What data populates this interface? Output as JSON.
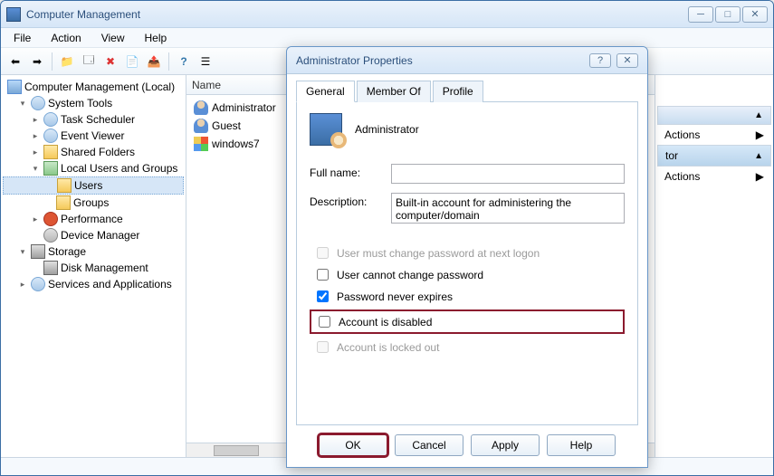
{
  "window": {
    "title": "Computer Management"
  },
  "menus": [
    "File",
    "Action",
    "View",
    "Help"
  ],
  "tree": {
    "root": "Computer Management (Local)",
    "nodes": [
      {
        "label": "System Tools",
        "level": 1,
        "expanded": true,
        "icon": "tool"
      },
      {
        "label": "Task Scheduler",
        "level": 2,
        "expanded": false,
        "icon": "tool"
      },
      {
        "label": "Event Viewer",
        "level": 2,
        "expanded": false,
        "icon": "tool"
      },
      {
        "label": "Shared Folders",
        "level": 2,
        "expanded": false,
        "icon": "folder"
      },
      {
        "label": "Local Users and Groups",
        "level": 2,
        "expanded": true,
        "icon": "users"
      },
      {
        "label": "Users",
        "level": 3,
        "expanded": null,
        "icon": "folder",
        "selected": true
      },
      {
        "label": "Groups",
        "level": 3,
        "expanded": null,
        "icon": "folder"
      },
      {
        "label": "Performance",
        "level": 2,
        "expanded": false,
        "icon": "red"
      },
      {
        "label": "Device Manager",
        "level": 2,
        "expanded": null,
        "icon": "gear"
      },
      {
        "label": "Storage",
        "level": 1,
        "expanded": true,
        "icon": "disk"
      },
      {
        "label": "Disk Management",
        "level": 2,
        "expanded": null,
        "icon": "disk"
      },
      {
        "label": "Services and Applications",
        "level": 1,
        "expanded": false,
        "icon": "tool"
      }
    ]
  },
  "list": {
    "column": "Name",
    "rows": [
      {
        "name": "Administrator",
        "icon": "user"
      },
      {
        "name": "Guest",
        "icon": "user"
      },
      {
        "name": "windows7",
        "icon": "windows"
      }
    ]
  },
  "actions": {
    "header1": "Actions",
    "item1": "tor",
    "header2": "Actions"
  },
  "dialog": {
    "title": "Administrator Properties",
    "tabs": [
      "General",
      "Member Of",
      "Profile"
    ],
    "active_tab": 0,
    "username": "Administrator",
    "fullname_label": "Full name:",
    "fullname_value": "",
    "description_label": "Description:",
    "description_value": "Built-in account for administering the computer/domain",
    "checkboxes": [
      {
        "label": "User must change password at next logon",
        "checked": false,
        "disabled": true
      },
      {
        "label": "User cannot change password",
        "checked": false,
        "disabled": false
      },
      {
        "label": "Password never expires",
        "checked": true,
        "disabled": false
      },
      {
        "label": "Account is disabled",
        "checked": false,
        "disabled": false,
        "highlighted": true
      },
      {
        "label": "Account is locked out",
        "checked": false,
        "disabled": true
      }
    ],
    "buttons": {
      "ok": "OK",
      "cancel": "Cancel",
      "apply": "Apply",
      "help": "Help"
    }
  }
}
